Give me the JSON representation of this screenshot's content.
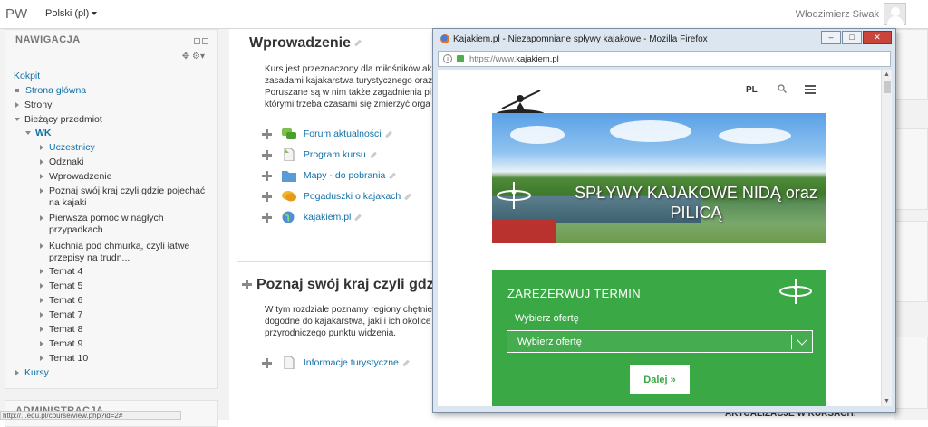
{
  "navbar": {
    "brand": "PW",
    "language": "Polski (pl)",
    "username": "Włodzimierz Siwak"
  },
  "sidebar": {
    "nav_title": "NAWIGACJA",
    "items": [
      {
        "label": "Kokpit",
        "type": "link",
        "level": 0
      },
      {
        "label": "Strona główna",
        "type": "link",
        "level": 1,
        "marker": "bullet"
      },
      {
        "label": "Strony",
        "type": "text",
        "level": 1,
        "marker": "collapsed"
      },
      {
        "label": "Bieżący przedmiot",
        "type": "text",
        "level": 1,
        "marker": "expanded"
      },
      {
        "label": "WK",
        "type": "link",
        "level": 2,
        "marker": "expanded"
      },
      {
        "label": "Uczestnicy",
        "type": "link",
        "level": 3,
        "marker": "collapsed"
      },
      {
        "label": "Odznaki",
        "type": "text",
        "level": 3,
        "marker": "collapsed"
      },
      {
        "label": "Wprowadzenie",
        "type": "text",
        "level": 3,
        "marker": "collapsed"
      },
      {
        "label": "Poznaj swój kraj czyli gdzie pojechać",
        "label2": "na kajaki",
        "type": "text",
        "level": 3,
        "marker": "collapsed"
      },
      {
        "label": "Pierwsza pomoc w nagłych",
        "label2": "przypadkach",
        "type": "text",
        "level": 3,
        "marker": "collapsed"
      },
      {
        "label": "Kuchnia pod chmurką, czyli łatwe",
        "label2": "przepisy na trudn...",
        "type": "text",
        "level": 3,
        "marker": "collapsed"
      },
      {
        "label": "Temat 4",
        "type": "text",
        "level": 3,
        "marker": "collapsed"
      },
      {
        "label": "Temat 5",
        "type": "text",
        "level": 3,
        "marker": "collapsed"
      },
      {
        "label": "Temat 6",
        "type": "text",
        "level": 3,
        "marker": "collapsed"
      },
      {
        "label": "Temat 7",
        "type": "text",
        "level": 3,
        "marker": "collapsed"
      },
      {
        "label": "Temat 8",
        "type": "text",
        "level": 3,
        "marker": "collapsed"
      },
      {
        "label": "Temat 9",
        "type": "text",
        "level": 3,
        "marker": "collapsed"
      },
      {
        "label": "Temat 10",
        "type": "text",
        "level": 3,
        "marker": "collapsed"
      },
      {
        "label": "Kursy",
        "type": "link",
        "level": 1,
        "marker": "collapsed"
      }
    ],
    "admin_title": "ADMINISTRACJA",
    "status_url": "http://...edu.pl/course/view.php?id=2#"
  },
  "main": {
    "section1": {
      "title": "Wprowadzenie",
      "desc": [
        "Kurs jest przeznaczony dla miłośników ak",
        "zasadami kajakarstwa turystycznego oraz",
        "Poruszane są w nim także zagadnienia pi",
        "którymi trzeba czasami się zmierzyć orga"
      ],
      "activities": [
        {
          "label": "Forum aktualności",
          "icon": "forum-icon"
        },
        {
          "label": "Program kursu",
          "icon": "file-icon"
        },
        {
          "label": "Mapy - do pobrania",
          "icon": "folder-icon"
        },
        {
          "label": "Pogaduszki o kajakach",
          "icon": "chat-icon"
        },
        {
          "label": "kajakiem.pl",
          "icon": "url-globe-icon"
        }
      ]
    },
    "section2": {
      "title": "Poznaj swój kraj czyli gdz",
      "desc": [
        "W tym rozdziale poznamy regiony chętnie",
        "dogodne do kajakarstwa, jaki i ich okolice",
        "przyrodniczego punktu widzenia."
      ],
      "activities": [
        {
          "label": "Informacje turystyczne",
          "icon": "file-icon"
        }
      ]
    },
    "right_bottom_title": "AKTUALIZACJE W KURSACH:"
  },
  "popup": {
    "window_title": "Kajakiem.pl - Niezapomniane spływy kajakowe - Mozilla Firefox",
    "url_prefix": "https://www.",
    "url_domain": "kajakiem.pl",
    "site": {
      "lang": "PL",
      "hero_text": "SPŁYWY KAJAKOWE NIDĄ oraz PILICĄ",
      "booking_title": "ZAREZERWUJ TERMIN",
      "offer_label": "Wybierz ofertę",
      "offer_select": "Wybierz ofertę",
      "next_button": "Dalej »"
    }
  },
  "colors": {
    "link": "#1170a7",
    "booking_green": "#3aa844",
    "window_frame": "#dce6f0",
    "close_button": "#c9443a"
  }
}
